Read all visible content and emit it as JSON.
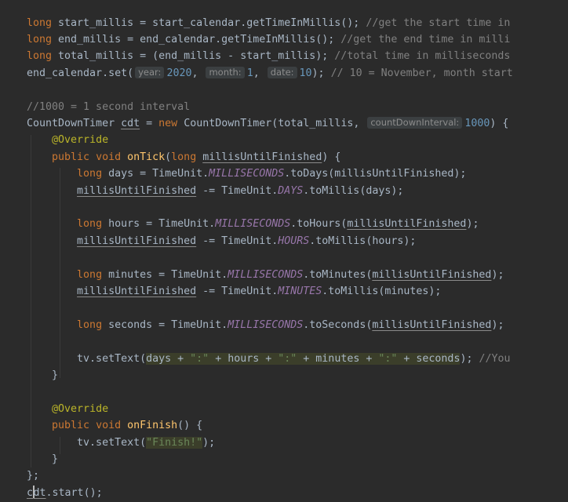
{
  "code": {
    "current_line": 29,
    "lines": [
      [
        {
          "t": "long",
          "c": "kw"
        },
        {
          "t": " start_millis = start_calendar.getTimeInMillis(); "
        },
        {
          "t": "//get the start time in",
          "c": "cm"
        }
      ],
      [
        {
          "t": "long",
          "c": "kw"
        },
        {
          "t": " end_millis = end_calendar.getTimeInMillis(); "
        },
        {
          "t": "//get the end time in milli",
          "c": "cm"
        }
      ],
      [
        {
          "t": "long",
          "c": "kw"
        },
        {
          "t": " total_millis = (end_millis - start_millis); "
        },
        {
          "t": "//total time in milliseconds",
          "c": "cm"
        }
      ],
      [
        {
          "t": "end_calendar.set("
        },
        {
          "t": "year:",
          "c": "hint"
        },
        {
          "t": "2020",
          "c": "num"
        },
        {
          "t": ", "
        },
        {
          "t": "month:",
          "c": "hint"
        },
        {
          "t": "1",
          "c": "num"
        },
        {
          "t": ", "
        },
        {
          "t": "date:",
          "c": "hint"
        },
        {
          "t": "10",
          "c": "num"
        },
        {
          "t": "); "
        },
        {
          "t": "// 10 = November, month start",
          "c": "cm"
        }
      ],
      [],
      [
        {
          "t": "//1000 = 1 second interval",
          "c": "cm"
        }
      ],
      [
        {
          "t": "CountDownTimer "
        },
        {
          "t": "cdt",
          "c": "ul"
        },
        {
          "t": " = "
        },
        {
          "t": "new",
          "c": "kw"
        },
        {
          "t": " CountDownTimer(total_millis, "
        },
        {
          "t": "countDownInterval:",
          "c": "hint"
        },
        {
          "t": "1000",
          "c": "num"
        },
        {
          "t": ") {"
        }
      ],
      [
        {
          "t": "    "
        },
        {
          "t": "@Override",
          "c": "ann"
        }
      ],
      [
        {
          "t": "    "
        },
        {
          "t": "public void",
          "c": "kw"
        },
        {
          "t": " "
        },
        {
          "t": "onTick",
          "c": "fn"
        },
        {
          "t": "("
        },
        {
          "t": "long",
          "c": "kw"
        },
        {
          "t": " "
        },
        {
          "t": "millisUntilFinished",
          "c": "ul"
        },
        {
          "t": ") {"
        }
      ],
      [
        {
          "t": "        "
        },
        {
          "t": "long",
          "c": "kw"
        },
        {
          "t": " days = TimeUnit."
        },
        {
          "t": "MILLISECONDS",
          "c": "cst"
        },
        {
          "t": ".toDays(millisUntilFinished);"
        }
      ],
      [
        {
          "t": "        "
        },
        {
          "t": "millisUntilFinished",
          "c": "ul"
        },
        {
          "t": " -= TimeUnit."
        },
        {
          "t": "DAYS",
          "c": "cst"
        },
        {
          "t": ".toMillis(days);"
        }
      ],
      [],
      [
        {
          "t": "        "
        },
        {
          "t": "long",
          "c": "kw"
        },
        {
          "t": " hours = TimeUnit."
        },
        {
          "t": "MILLISECONDS",
          "c": "cst"
        },
        {
          "t": ".toHours("
        },
        {
          "t": "millisUntilFinished",
          "c": "ul"
        },
        {
          "t": ");"
        }
      ],
      [
        {
          "t": "        "
        },
        {
          "t": "millisUntilFinished",
          "c": "ul"
        },
        {
          "t": " -= TimeUnit."
        },
        {
          "t": "HOURS",
          "c": "cst"
        },
        {
          "t": ".toMillis(hours);"
        }
      ],
      [],
      [
        {
          "t": "        "
        },
        {
          "t": "long",
          "c": "kw"
        },
        {
          "t": " minutes = TimeUnit."
        },
        {
          "t": "MILLISECONDS",
          "c": "cst"
        },
        {
          "t": ".toMinutes("
        },
        {
          "t": "millisUntilFinished",
          "c": "ul"
        },
        {
          "t": ");"
        }
      ],
      [
        {
          "t": "        "
        },
        {
          "t": "millisUntilFinished",
          "c": "ul"
        },
        {
          "t": " -= TimeUnit."
        },
        {
          "t": "MINUTES",
          "c": "cst"
        },
        {
          "t": ".toMillis(minutes);"
        }
      ],
      [],
      [
        {
          "t": "        "
        },
        {
          "t": "long",
          "c": "kw"
        },
        {
          "t": " seconds = TimeUnit."
        },
        {
          "t": "MILLISECONDS",
          "c": "cst"
        },
        {
          "t": ".toSeconds("
        },
        {
          "t": "millisUntilFinished",
          "c": "ul"
        },
        {
          "t": ");"
        }
      ],
      [],
      [
        {
          "t": "        tv.setText("
        },
        {
          "t": "days + ",
          "c": "hl"
        },
        {
          "t": "\":\"",
          "c": "str hl"
        },
        {
          "t": " + hours + ",
          "c": "hl"
        },
        {
          "t": "\":\"",
          "c": "str hl"
        },
        {
          "t": " + minutes + ",
          "c": "hl"
        },
        {
          "t": "\":\"",
          "c": "str hl"
        },
        {
          "t": " + seconds",
          "c": "hl"
        },
        {
          "t": "); "
        },
        {
          "t": "//You",
          "c": "cm"
        }
      ],
      [
        {
          "t": "    }"
        }
      ],
      [],
      [
        {
          "t": "    "
        },
        {
          "t": "@Override",
          "c": "ann"
        }
      ],
      [
        {
          "t": "    "
        },
        {
          "t": "public void",
          "c": "kw"
        },
        {
          "t": " "
        },
        {
          "t": "onFinish",
          "c": "fn"
        },
        {
          "t": "() {"
        }
      ],
      [
        {
          "t": "        tv.setText("
        },
        {
          "t": "\"Finish!\"",
          "c": "str hl"
        },
        {
          "t": ");"
        }
      ],
      [
        {
          "t": "    }"
        }
      ],
      [
        {
          "t": "};"
        }
      ],
      [
        {
          "t": "c",
          "c": "ul"
        },
        {
          "t": "",
          "c": "caret"
        },
        {
          "t": "dt",
          "c": "ul"
        },
        {
          "t": ".start();"
        }
      ]
    ]
  }
}
